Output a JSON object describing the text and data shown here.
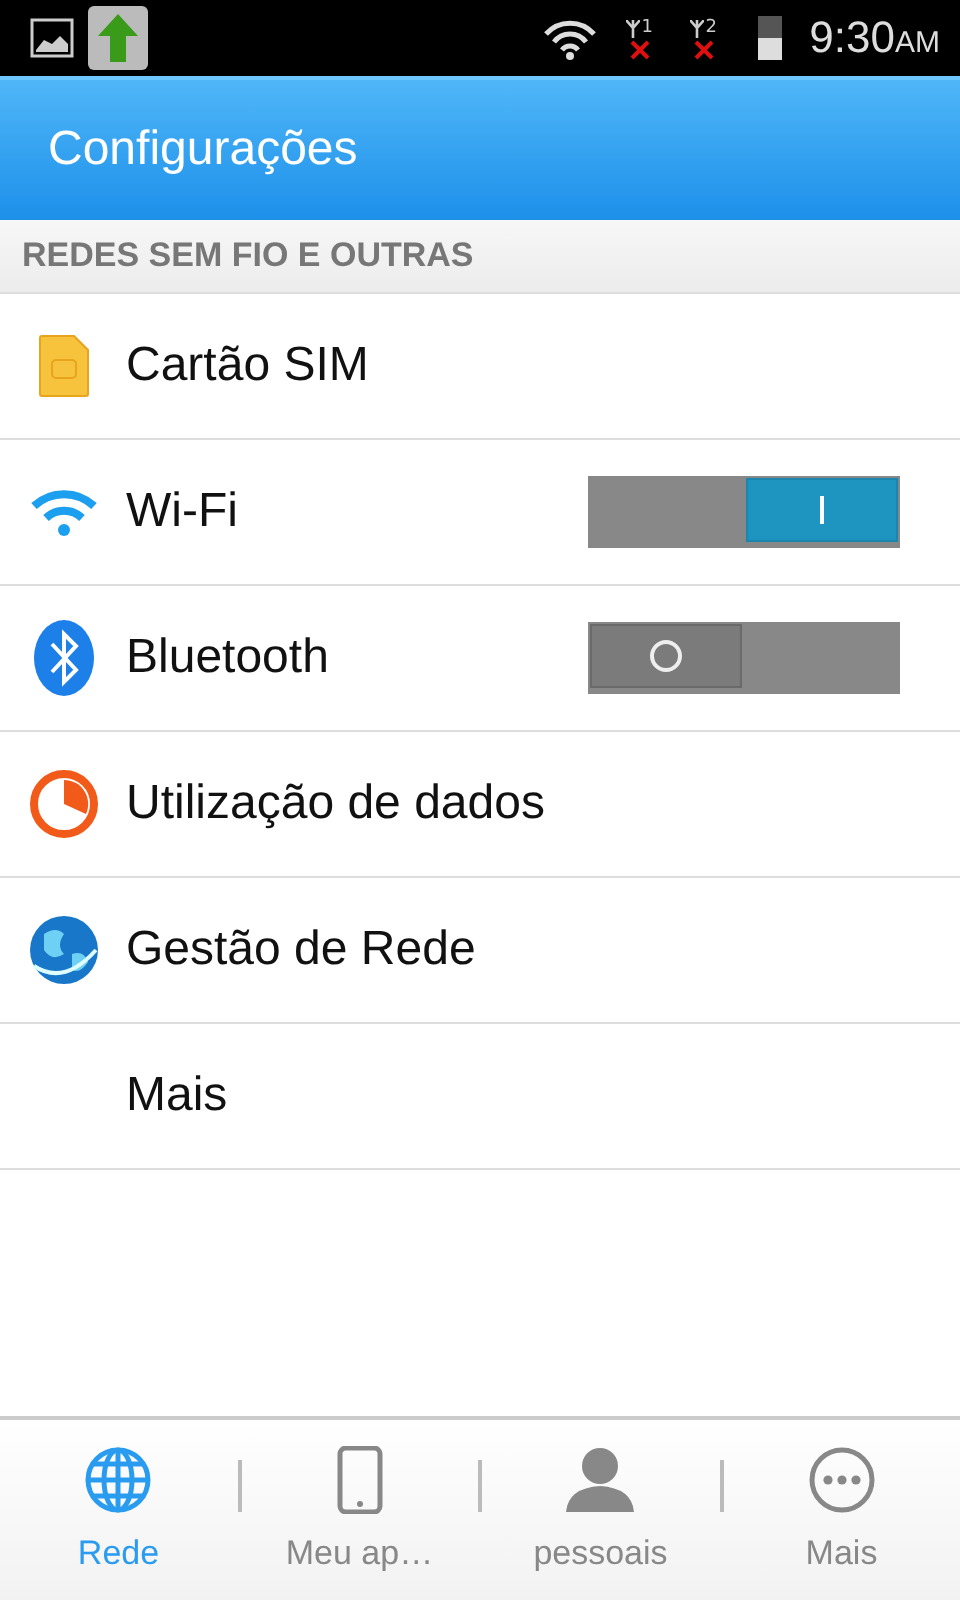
{
  "status_bar": {
    "sims": [
      {
        "label": "1",
        "no_signal": true
      },
      {
        "label": "2",
        "no_signal": true
      }
    ],
    "time": "9:30",
    "meridiem": "AM"
  },
  "header": {
    "title": "Configurações"
  },
  "section": {
    "title": "REDES SEM FIO E OUTRAS"
  },
  "items": [
    {
      "kind": "sim",
      "label": "Cartão SIM"
    },
    {
      "kind": "wifi",
      "label": "Wi-Fi",
      "toggle": {
        "on": true
      }
    },
    {
      "kind": "bluetooth",
      "label": "Bluetooth",
      "toggle": {
        "on": false
      }
    },
    {
      "kind": "data",
      "label": "Utilização de dados"
    },
    {
      "kind": "network",
      "label": "Gestão de Rede"
    },
    {
      "kind": "none",
      "label": "Mais"
    }
  ],
  "tabs": [
    {
      "kind": "globe",
      "label": "Rede",
      "selected": true
    },
    {
      "kind": "phone",
      "label": "Meu ap…",
      "selected": false
    },
    {
      "kind": "person",
      "label": "pessoais",
      "selected": false
    },
    {
      "kind": "more",
      "label": "Mais",
      "selected": false
    }
  ]
}
